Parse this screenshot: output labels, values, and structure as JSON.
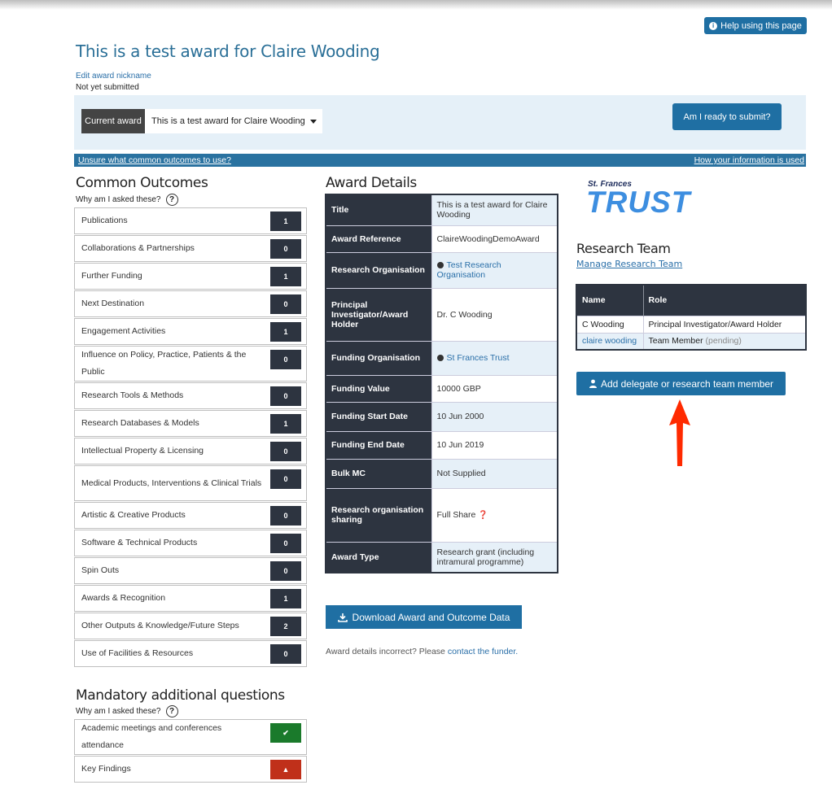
{
  "help_label": "Help using this page",
  "page_title": "This is a test award for Claire Wooding",
  "edit_nickname": "Edit award nickname",
  "status": "Not yet submitted",
  "current_award_label": "Current award",
  "current_award_value": "This is a test award for Claire Wooding",
  "ready_button": "Am I ready to submit?",
  "band": {
    "left_link": "Unsure what common outcomes to use?",
    "right_link": "How your information is used"
  },
  "outcomes": {
    "heading": "Common Outcomes",
    "why": "Why am I asked these?",
    "items": [
      {
        "label": "Publications",
        "count": "1"
      },
      {
        "label": "Collaborations & Partnerships",
        "count": "0"
      },
      {
        "label": "Further Funding",
        "count": "1"
      },
      {
        "label": "Next Destination",
        "count": "0"
      },
      {
        "label": "Engagement Activities",
        "count": "1"
      },
      {
        "label": "Influence on Policy, Practice, Patients & the Public",
        "count": "0"
      },
      {
        "label": "Research Tools & Methods",
        "count": "0"
      },
      {
        "label": "Research Databases & Models",
        "count": "1"
      },
      {
        "label": "Intellectual Property & Licensing",
        "count": "0"
      },
      {
        "label": "Medical Products, Interventions & Clinical Trials",
        "count": "0"
      },
      {
        "label": "Artistic & Creative Products",
        "count": "0"
      },
      {
        "label": "Software & Technical Products",
        "count": "0"
      },
      {
        "label": "Spin Outs",
        "count": "0"
      },
      {
        "label": "Awards & Recognition",
        "count": "1"
      },
      {
        "label": "Other Outputs & Knowledge/Future Steps",
        "count": "2"
      },
      {
        "label": "Use of Facilities & Resources",
        "count": "0"
      }
    ]
  },
  "mandatory": {
    "heading": "Mandatory additional questions",
    "why": "Why am I asked these?",
    "items": [
      {
        "label": "Academic meetings and conferences attendance",
        "status": "check-icon"
      },
      {
        "label": "Key Findings",
        "status": "warning-icon"
      }
    ]
  },
  "details": {
    "heading": "Award Details",
    "rows": [
      {
        "key": "Title",
        "value": "This is a test award for Claire Wooding"
      },
      {
        "key": "Award Reference",
        "value": "ClaireWoodingDemoAward"
      },
      {
        "key": "Research Organisation",
        "value": "Test Research Organisation"
      },
      {
        "key": "Principal Investigator/Award Holder",
        "value": "Dr. C Wooding"
      },
      {
        "key": "Funding Organisation",
        "value": "St Frances Trust"
      },
      {
        "key": "Funding Value",
        "value": "10000 GBP"
      },
      {
        "key": "Funding Start Date",
        "value": "10 Jun 2000"
      },
      {
        "key": "Funding End Date",
        "value": "10 Jun 2019"
      },
      {
        "key": "Bulk MC",
        "value": "Not Supplied"
      },
      {
        "key": "Research organisation sharing",
        "value": "Full Share"
      },
      {
        "key": "Award Type",
        "value": "Research grant (including intramural programme)"
      }
    ]
  },
  "download_button": "Download Award and Outcome Data",
  "incorrect_text": "Award details incorrect? Please",
  "incorrect_link": "contact the funder.",
  "logo": {
    "small": "St. Frances",
    "big": "TRUST"
  },
  "team": {
    "heading": "Research Team",
    "manage_link": "Manage Research Team",
    "columns": [
      "Name",
      "Role"
    ],
    "rows": [
      {
        "name": "C Wooding",
        "role": "Principal Investigator/Award Holder",
        "pending": ""
      },
      {
        "name": "claire wooding",
        "role": "Team Member",
        "pending": "(pending)"
      }
    ]
  },
  "add_member_button": "Add delegate or research team member",
  "colors": {
    "accent": "#1f6fa3",
    "dark": "#2d3440",
    "band": "#2a72a0",
    "arrow": "#ff2a00"
  }
}
